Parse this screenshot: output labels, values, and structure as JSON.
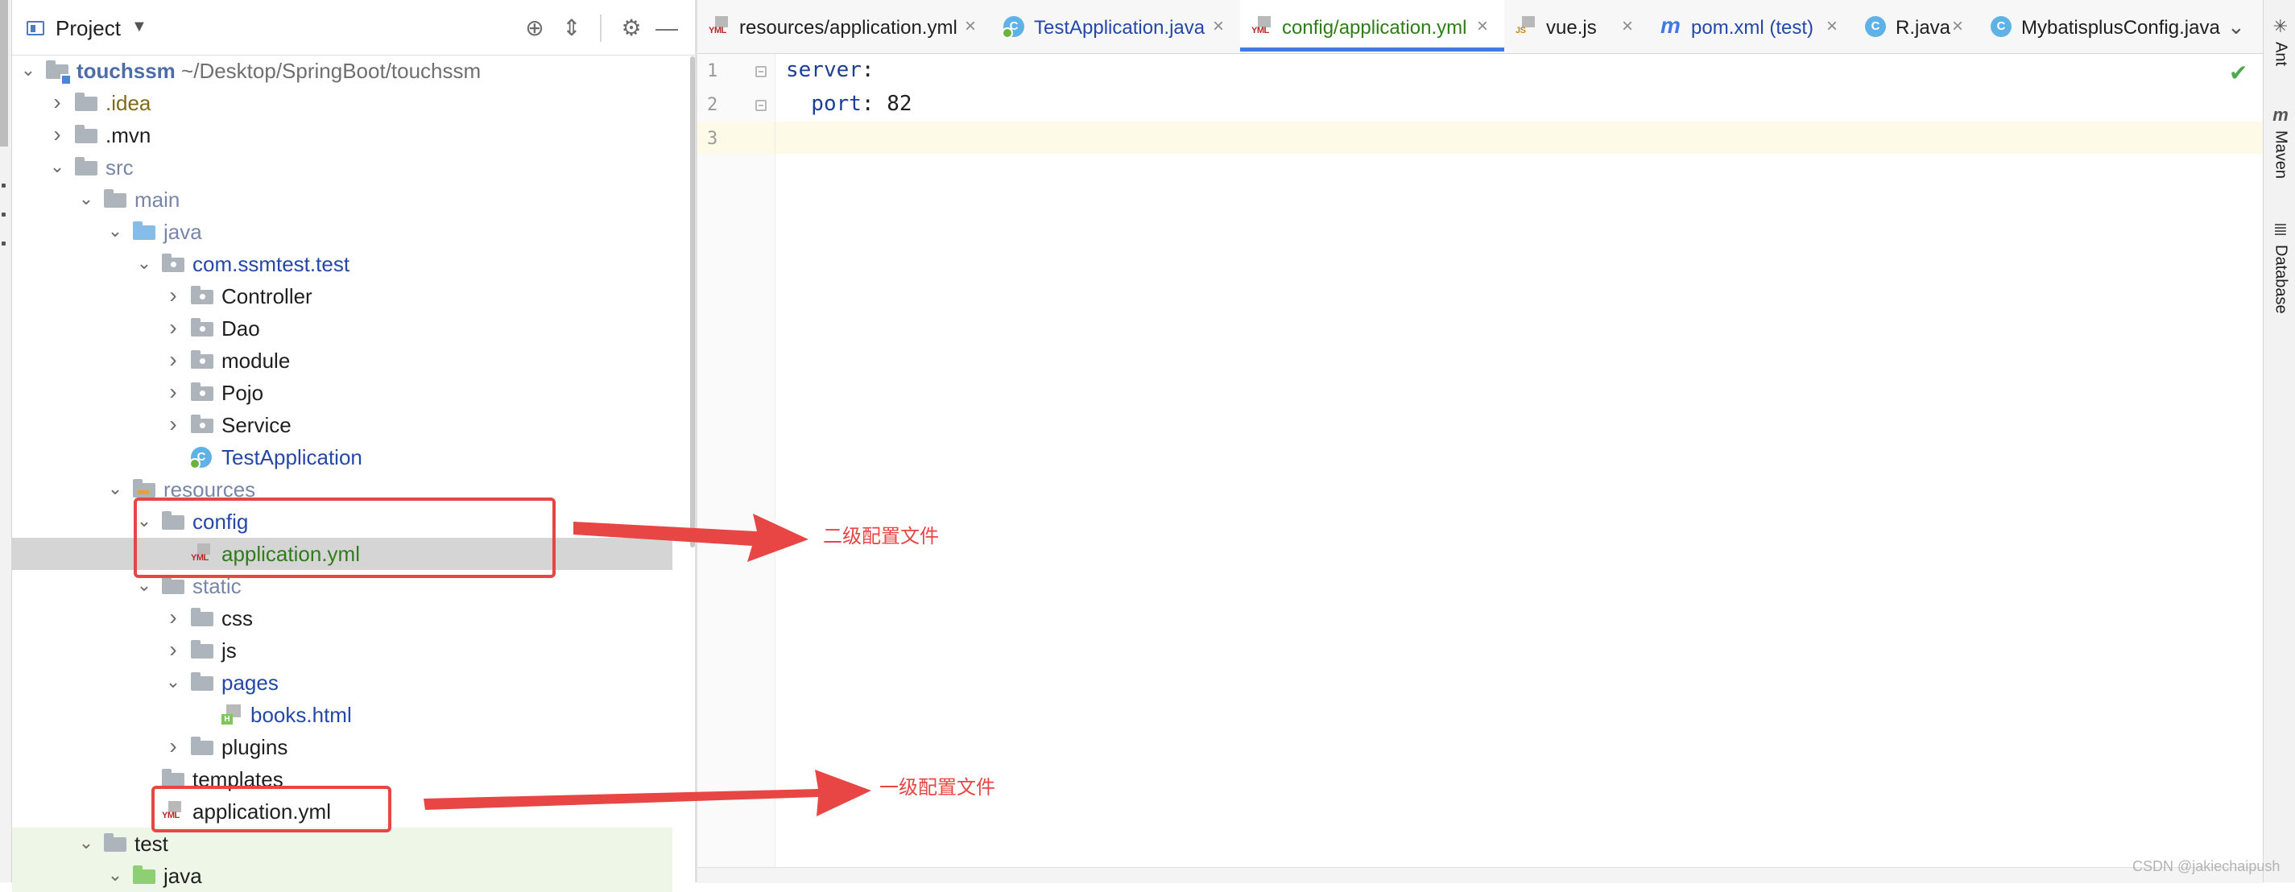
{
  "project_panel": {
    "title": "Project",
    "dropdown_icon": "caret-down-icon",
    "header_buttons": [
      "locate-icon",
      "collapse-all-icon",
      "gear-icon",
      "hide-icon"
    ]
  },
  "tree": [
    {
      "label": "touchssm",
      "suffix": " ~/Desktop/SpringBoot/touchssm",
      "icon": "module-folder",
      "expanded": true,
      "indent": 0,
      "style": "bold"
    },
    {
      "label": ".idea",
      "icon": "folder",
      "expanded": false,
      "indent": 1,
      "style": "olive"
    },
    {
      "label": ".mvn",
      "icon": "folder",
      "expanded": false,
      "indent": 1,
      "style": "dark"
    },
    {
      "label": "src",
      "icon": "folder",
      "expanded": true,
      "indent": 1,
      "style": "gray"
    },
    {
      "label": "main",
      "icon": "folder",
      "expanded": true,
      "indent": 2,
      "style": "gray"
    },
    {
      "label": "java",
      "icon": "source-folder",
      "expanded": true,
      "indent": 3,
      "style": "gray"
    },
    {
      "label": "com.ssmtest.test",
      "icon": "package-folder",
      "expanded": true,
      "indent": 4,
      "style": "blue"
    },
    {
      "label": "Controller",
      "icon": "package-folder",
      "expanded": false,
      "indent": 5,
      "style": "dark"
    },
    {
      "label": "Dao",
      "icon": "package-folder",
      "expanded": false,
      "indent": 5,
      "style": "dark"
    },
    {
      "label": "module",
      "icon": "package-folder",
      "expanded": false,
      "indent": 5,
      "style": "dark"
    },
    {
      "label": "Pojo",
      "icon": "package-folder",
      "expanded": false,
      "indent": 5,
      "style": "dark"
    },
    {
      "label": "Service",
      "icon": "package-folder",
      "expanded": false,
      "indent": 5,
      "style": "dark"
    },
    {
      "label": "TestApplication",
      "icon": "spring-class",
      "expanded": null,
      "indent": 5,
      "style": "blue"
    },
    {
      "label": "resources",
      "icon": "resources-folder",
      "expanded": true,
      "indent": 3,
      "style": "gray"
    },
    {
      "label": "config",
      "icon": "folder",
      "expanded": true,
      "indent": 4,
      "style": "blue"
    },
    {
      "label": "application.yml",
      "icon": "yml-file",
      "expanded": null,
      "indent": 5,
      "style": "green",
      "selected": true
    },
    {
      "label": "static",
      "icon": "folder",
      "expanded": true,
      "indent": 4,
      "style": "gray"
    },
    {
      "label": "css",
      "icon": "folder",
      "expanded": false,
      "indent": 5,
      "style": "dark"
    },
    {
      "label": "js",
      "icon": "folder",
      "expanded": false,
      "indent": 5,
      "style": "dark"
    },
    {
      "label": "pages",
      "icon": "folder",
      "expanded": true,
      "indent": 5,
      "style": "blue"
    },
    {
      "label": "books.html",
      "icon": "html-file",
      "expanded": null,
      "indent": 6,
      "style": "blue"
    },
    {
      "label": "plugins",
      "icon": "folder",
      "expanded": false,
      "indent": 5,
      "style": "dark"
    },
    {
      "label": "templates",
      "icon": "folder",
      "expanded": null,
      "indent": 4,
      "style": "dark"
    },
    {
      "label": "application.yml",
      "icon": "yml-file",
      "expanded": null,
      "indent": 4,
      "style": "dark"
    },
    {
      "label": "test",
      "icon": "folder",
      "expanded": true,
      "indent": 2,
      "style": "dark",
      "highlight": "test"
    },
    {
      "label": "java",
      "icon": "test-folder",
      "expanded": true,
      "indent": 3,
      "style": "dark",
      "highlight": "test"
    }
  ],
  "tabs": [
    {
      "label": "resources/application.yml",
      "icon": "yml-file-icon",
      "color": "#1f1f1f",
      "active": false
    },
    {
      "label": "TestApplication.java",
      "icon": "spring-class-icon",
      "color": "#2548a8",
      "active": false
    },
    {
      "label": "config/application.yml",
      "icon": "yml-file-icon",
      "color": "#2e7d1a",
      "active": true
    },
    {
      "label": "vue.js",
      "icon": "js-file-icon",
      "color": "#1f1f1f",
      "active": false
    },
    {
      "label": "pom.xml (test)",
      "icon": "maven-icon",
      "color": "#2548a8",
      "active": false
    },
    {
      "label": "R.java",
      "icon": "class-icon",
      "color": "#1f1f1f",
      "active": false
    },
    {
      "label": "MybatisplusConfig.java",
      "icon": "class-icon",
      "color": "#1f1f1f",
      "active": false
    }
  ],
  "editor": {
    "line_numbers": [
      "1",
      "2",
      "3"
    ],
    "lines": [
      [
        {
          "text": "server",
          "cls": "k-key"
        },
        {
          "text": ":",
          "cls": "k-punc"
        }
      ],
      [
        {
          "text": "  port",
          "cls": "k-key"
        },
        {
          "text": ": ",
          "cls": "k-punc"
        },
        {
          "text": "82",
          "cls": "k-num"
        }
      ],
      []
    ]
  },
  "right_tools": [
    {
      "label": "Ant",
      "icon": "ant-icon"
    },
    {
      "label": "Maven",
      "icon": "maven-icon"
    },
    {
      "label": "Database",
      "icon": "database-icon"
    }
  ],
  "annotations": {
    "secondary": "二级配置文件",
    "primary": "一级配置文件"
  },
  "watermark": "CSDN @jakiechaipush",
  "colors": {
    "accent": "#3f7be0",
    "annotation_red": "#e84545",
    "selected_row": "#d5d5d5"
  }
}
